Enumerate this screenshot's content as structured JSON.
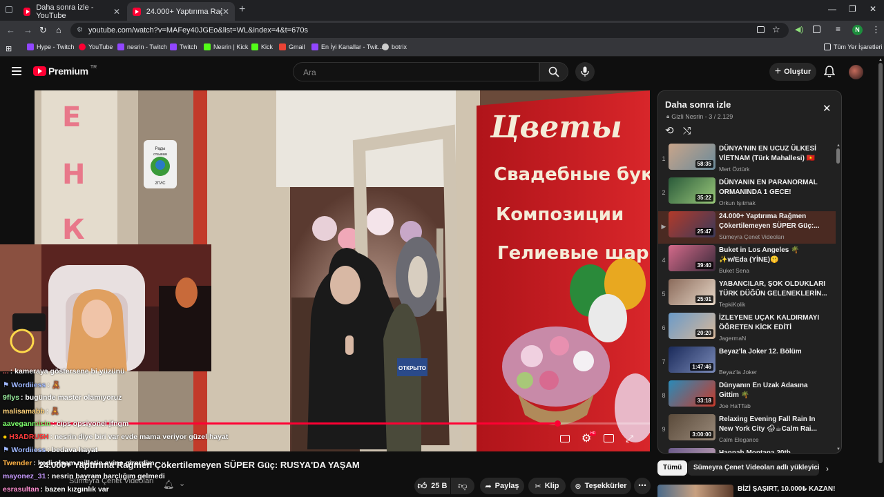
{
  "browser": {
    "tabs": [
      {
        "title": "Daha sonra izle - YouTube",
        "active": false
      },
      {
        "title": "24.000+ Yaptırıma Rağmen Çök",
        "active": true
      }
    ],
    "url": "youtube.com/watch?v=MAFey40JGEo&list=WL&index=4&t=670s",
    "profile_initial": "N",
    "bookmarks": [
      {
        "label": "Hype - Twitch",
        "color": "#9146ff"
      },
      {
        "label": "YouTube",
        "color": "#ff0033"
      },
      {
        "label": "nesrin - Twitch",
        "color": "#9146ff"
      },
      {
        "label": "Twitch",
        "color": "#9146ff"
      },
      {
        "label": "Nesrin | Kick",
        "color": "#53fc18"
      },
      {
        "label": "Kick",
        "color": "#53fc18"
      },
      {
        "label": "Gmail",
        "color": "#ea4335"
      },
      {
        "label": "En İyi Kanallar - Twit...",
        "color": "#9146ff"
      },
      {
        "label": "botrix",
        "color": "#cccccc"
      }
    ],
    "all_bookmarks": "Tüm Yer İşaretleri"
  },
  "youtube": {
    "logo_text": "Premium",
    "logo_sup": "TR",
    "search_placeholder": "Ara",
    "create_label": "Oluştur"
  },
  "video": {
    "shop_sign": [
      "Цветы",
      "Свадебные бук",
      "Композиции",
      "Гелиевые шар"
    ],
    "sticker_lines": [
      "Рады",
      "отзывам",
      "2ГИС"
    ],
    "side_letters": [
      "Е",
      "Н",
      "К"
    ],
    "door_text": "ОТКРЫТО",
    "progress": 0.85,
    "title": "24.000+ Yaptırıma Rağmen Çökertilemeyen SÜPER Güç: RUSYA'DA YAŞAM",
    "channel": "Sümeyra Çenet Videoları",
    "like_count": "25 B",
    "share_label": "Paylaş",
    "clip_label": "Klip",
    "thanks_label": "Teşekkürler"
  },
  "playlist": {
    "title": "Daha sonra izle",
    "meta": "Gizli  Nesrin - 3 / 2.129",
    "items": [
      {
        "n": "1",
        "title": "DÜNYA'NIN EN UCUZ ÜLKESİ VİETNAM (Türk Mahallesi) 🇻🇳",
        "channel": "Mert Öztürk",
        "dur": "58:35",
        "c1": "#c9a58a",
        "c2": "#6a8a9a",
        "current": false
      },
      {
        "n": "2",
        "title": "DÜNYANIN EN PARANORMAL ORMANINDA 1 GECE!",
        "channel": "Orkun Işıtmak",
        "dur": "35:22",
        "c1": "#2a5a3a",
        "c2": "#9ac87a",
        "current": false
      },
      {
        "n": "▶",
        "title": "24.000+ Yaptırıma Rağmen Çökertilemeyen SÜPER Güç:...",
        "channel": "Sümeyra Çenet Videoları",
        "dur": "25:47",
        "c1": "#b23a2a",
        "c2": "#3a3a5a",
        "current": true
      },
      {
        "n": "4",
        "title": "Buket in Los Angeles 🌴 ✨w/Eda (YİNE)🤫",
        "channel": "Buket Sena",
        "dur": "39:40",
        "c1": "#d46a8a",
        "c2": "#3a2a3a",
        "current": false
      },
      {
        "n": "5",
        "title": "YABANCILAR, ŞOK OLDUKLARI TÜRK DÜĞÜN GELENEKLERİN...",
        "channel": "TepkiKolik",
        "dur": "25:01",
        "c1": "#8a6a5a",
        "c2": "#e8d8c8",
        "current": false
      },
      {
        "n": "6",
        "title": "İZLEYENE UÇAK KALDIRMAYI ÖĞRETEN KİCK EDİTİ",
        "channel": "JagermaN",
        "dur": "20:20",
        "c1": "#6a9ac8",
        "c2": "#d8b89a",
        "current": false
      },
      {
        "n": "7",
        "title": "Beyaz'la Joker 12. Bölüm",
        "channel": "Beyaz'la Joker",
        "dur": "1:47:46",
        "c1": "#1a2a5a",
        "c2": "#7a8ab8",
        "current": false
      },
      {
        "n": "8",
        "title": "Dünyanın En Uzak Adasına Gittim 🌴",
        "channel": "Joe HaTTab",
        "dur": "33:18",
        "c1": "#2a8ab8",
        "c2": "#c83a2a",
        "current": false
      },
      {
        "n": "9",
        "title": "Relaxing Evening Fall Rain In New York City 🌧☕Calm Rai...",
        "channel": "Calm Elegance",
        "dur": "3:00:00",
        "c1": "#5a4a3a",
        "c2": "#9a8a7a",
        "current": false
      },
      {
        "n": "",
        "title": "Hannah Montana 20th",
        "channel": "",
        "dur": "",
        "c1": "#6a5a8a",
        "c2": "#c8a8b8",
        "current": false
      }
    ]
  },
  "chips": [
    "Tümü",
    "Sümeyra Çenet Videoları adlı yükleyiciden"
  ],
  "rec": {
    "title": "BİZİ ŞAŞIRT, 10.000₺ KAZAN!"
  },
  "chat": [
    {
      "user": "...",
      "color": "#ff6b6b",
      "msg": ": kameraya göstersene bi yüzünü"
    },
    {
      "user": "Wordiiess",
      "color": "#9fb8ff",
      "msg": ": 🧸"
    },
    {
      "user": "9flys",
      "color": "#9cf0a0",
      "msg": ": bugünde master olamıyoruz"
    },
    {
      "user": "malisamabb",
      "color": "#ffd27a",
      "msg": ": 🧸"
    },
    {
      "user": "aaveganmisin",
      "color": "#7cff6b",
      "msg": ": cips opsiyonel jfngm"
    },
    {
      "user": "H3ADRU5H",
      "color": "#ff3b3b",
      "msg": ": nesrin diye biri var evde mama veriyor güzel hayat"
    },
    {
      "user": "Wordiiess",
      "color": "#9fb8ff",
      "msg": ": bedava hayat"
    },
    {
      "user": "Twender",
      "color": "#ffb347",
      "msg": ": kedi olsam milletin evine girerdim"
    },
    {
      "user": "mayonez_31",
      "color": "#c89bff",
      "msg": ": nesrin bayram harçlığım gelmedi"
    },
    {
      "user": "esrasultan",
      "color": "#ff8fd0",
      "msg": ": bazen kızgınlık var"
    }
  ]
}
